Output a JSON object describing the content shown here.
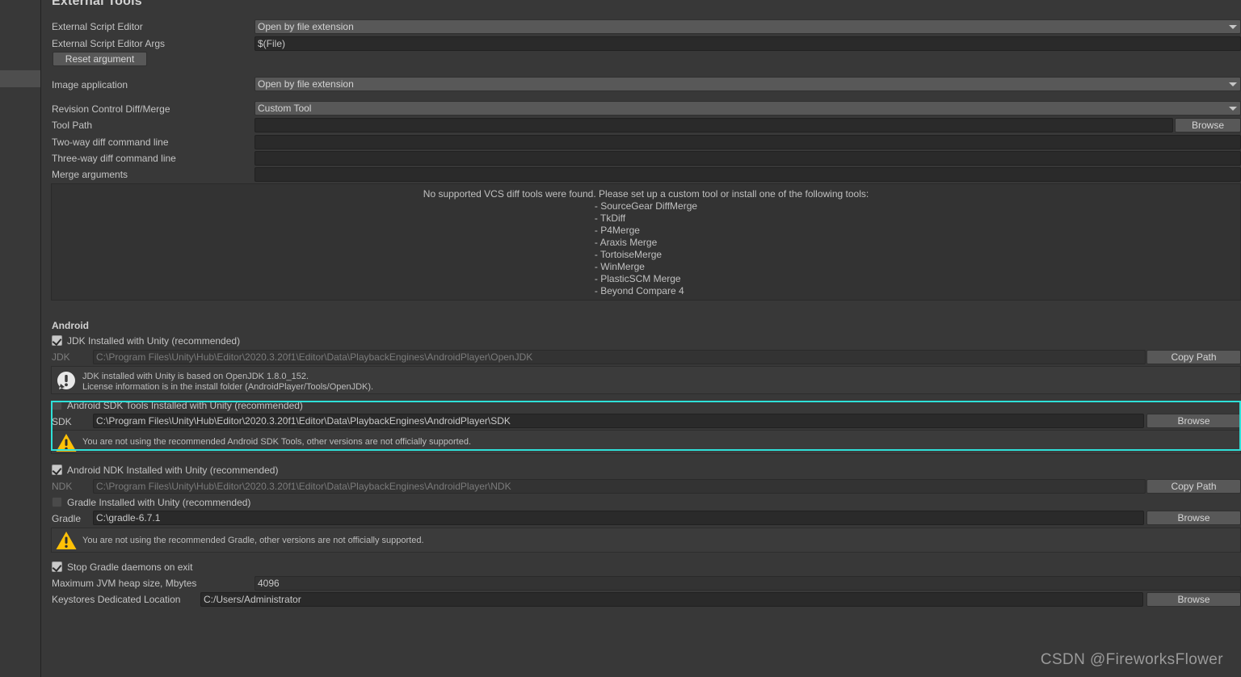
{
  "window": {
    "title": "External Tools",
    "background": "#383838",
    "highlight_color": "#2ee0d8"
  },
  "external_tools": {
    "script_editor": {
      "label": "External Script Editor",
      "value": "Open by file extension"
    },
    "script_editor_args": {
      "label": "External Script Editor Args",
      "value": "$(File)"
    },
    "reset_argument_button": "Reset argument",
    "image_application": {
      "label": "Image application",
      "value": "Open by file extension"
    },
    "revision_control": {
      "label": "Revision Control Diff/Merge",
      "value": "Custom Tool"
    },
    "tool_path": {
      "label": "Tool Path",
      "value": "",
      "browse_label": "Browse"
    },
    "two_way_diff": {
      "label": "Two-way diff command line",
      "value": ""
    },
    "three_way_diff": {
      "label": "Three-way diff command line",
      "value": ""
    },
    "merge_arguments": {
      "label": "Merge arguments",
      "value": ""
    },
    "vcs_notice": {
      "heading": "No supported VCS diff tools were found. Please set up a custom tool or install one of the following tools:",
      "tools": [
        "- SourceGear DiffMerge",
        "- TkDiff",
        "- P4Merge",
        "- Araxis Merge",
        "- TortoiseMerge",
        "- WinMerge",
        "- PlasticSCM Merge",
        "- Beyond Compare 4"
      ]
    }
  },
  "android": {
    "section_title": "Android",
    "jdk": {
      "checkbox_label": "JDK Installed with Unity (recommended)",
      "checked": true,
      "field_label": "JDK",
      "field_value": "C:\\Program Files\\Unity\\Hub\\Editor\\2020.3.20f1\\Editor\\Data\\PlaybackEngines\\AndroidPlayer\\OpenJDK",
      "button_label": "Copy Path",
      "info_icon": "info-icon",
      "info_text": "JDK installed with Unity is based on OpenJDK 1.8.0_152.\nLicense information is in the install folder (AndroidPlayer/Tools/OpenJDK)."
    },
    "sdk": {
      "checkbox_label": "Android SDK Tools Installed with Unity (recommended)",
      "checked": false,
      "field_label": "SDK",
      "field_value": "C:\\Program Files\\Unity\\Hub\\Editor\\2020.3.20f1\\Editor\\Data\\PlaybackEngines\\AndroidPlayer\\SDK",
      "button_label": "Browse",
      "warn_icon": "warning-icon",
      "warn_text": "You are not using the recommended Android SDK Tools, other versions are not officially supported.",
      "highlighted": true
    },
    "ndk": {
      "checkbox_label": "Android NDK Installed with Unity (recommended)",
      "checked": true,
      "field_label": "NDK",
      "field_value": "C:\\Program Files\\Unity\\Hub\\Editor\\2020.3.20f1\\Editor\\Data\\PlaybackEngines\\AndroidPlayer\\NDK",
      "button_label": "Copy Path"
    },
    "gradle": {
      "checkbox_label": "Gradle Installed with Unity (recommended)",
      "checked": false,
      "field_label": "Gradle",
      "field_value": "C:\\gradle-6.7.1",
      "button_label": "Browse",
      "warn_icon": "warning-icon",
      "warn_text": "You are not using the recommended Gradle, other versions are not officially supported."
    },
    "stop_daemons": {
      "checkbox_label": "Stop Gradle daemons on exit",
      "checked": true
    },
    "jvm_heap": {
      "label": "Maximum JVM heap size, Mbytes",
      "value": "4096"
    },
    "keystores": {
      "label": "Keystores Dedicated Location",
      "value": "C:/Users/Administrator",
      "button_label": "Browse"
    }
  },
  "watermark": "CSDN @FireworksFlower"
}
